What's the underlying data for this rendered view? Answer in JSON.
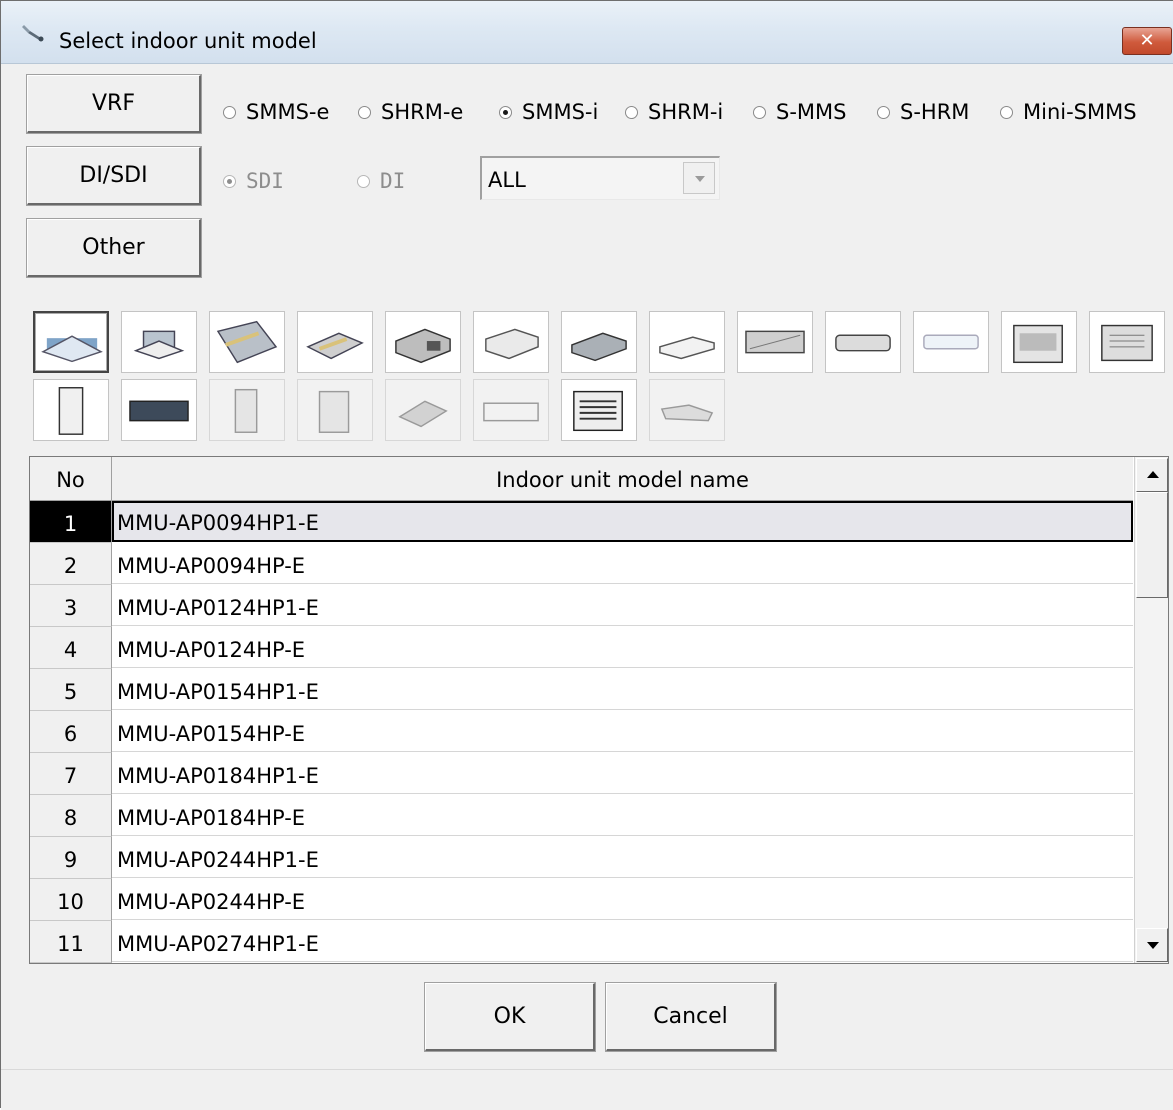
{
  "window": {
    "title": "Select indoor unit model",
    "close_label": "✕"
  },
  "categories": {
    "vrf": "VRF",
    "di_sdi": "DI/SDI",
    "other": "Other"
  },
  "vrf_series": [
    {
      "label": "SMMS-e",
      "checked": false
    },
    {
      "label": "SHRM-e",
      "checked": false
    },
    {
      "label": "SMMS-i",
      "checked": true
    },
    {
      "label": "SHRM-i",
      "checked": false
    },
    {
      "label": "S-MMS",
      "checked": false
    },
    {
      "label": "S-HRM",
      "checked": false
    },
    {
      "label": "Mini-SMMS",
      "checked": false
    }
  ],
  "di_sdi_options": {
    "sdi": {
      "label": "SDI",
      "checked": true
    },
    "di": {
      "label": "DI",
      "checked": false
    },
    "filter_value": "ALL"
  },
  "unit_types": [
    "4-way-cassette-icon",
    "compact-4-way-cassette-icon",
    "2-way-cassette-icon",
    "1-way-cassette-icon",
    "concealed-duct-standard-icon",
    "slim-duct-icon",
    "concealed-duct-high-static-icon",
    "under-ceiling-icon",
    "high-wall-icon",
    "high-wall-slim-icon",
    "high-wall-white-icon",
    "floor-standing-cabinet-icon",
    "floor-standing-concealed-icon",
    "floor-standing-tall-icon",
    "fresh-air-intake-icon",
    "floor-standing-box-icon",
    "console-icon",
    "air-to-air-heat-exchanger-icon",
    "duct-heat-exchanger-icon",
    "floor-console-icon",
    "ceiling-grille-icon"
  ],
  "table": {
    "col_no": "No",
    "col_name": "Indoor unit model name",
    "rows": [
      {
        "no": "1",
        "name": "MMU-AP0094HP1-E"
      },
      {
        "no": "2",
        "name": "MMU-AP0094HP-E"
      },
      {
        "no": "3",
        "name": "MMU-AP0124HP1-E"
      },
      {
        "no": "4",
        "name": "MMU-AP0124HP-E"
      },
      {
        "no": "5",
        "name": "MMU-AP0154HP1-E"
      },
      {
        "no": "6",
        "name": "MMU-AP0154HP-E"
      },
      {
        "no": "7",
        "name": "MMU-AP0184HP1-E"
      },
      {
        "no": "8",
        "name": "MMU-AP0184HP-E"
      },
      {
        "no": "9",
        "name": "MMU-AP0244HP1-E"
      },
      {
        "no": "10",
        "name": "MMU-AP0244HP-E"
      },
      {
        "no": "11",
        "name": "MMU-AP0274HP1-E"
      }
    ]
  },
  "buttons": {
    "ok": "OK",
    "cancel": "Cancel"
  }
}
